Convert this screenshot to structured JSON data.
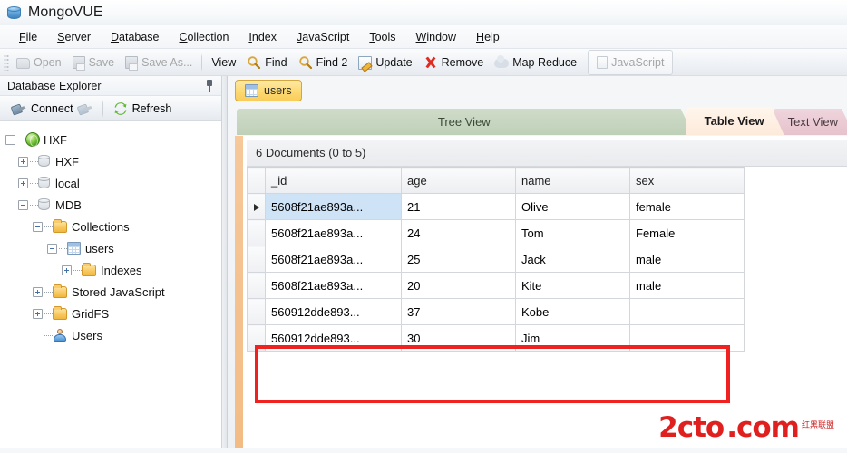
{
  "window": {
    "title": "MongoVUE",
    "icon": "database-icon"
  },
  "menu": {
    "items": [
      {
        "label": "File",
        "mnemonic": "F"
      },
      {
        "label": "Server",
        "mnemonic": "S"
      },
      {
        "label": "Database",
        "mnemonic": "D"
      },
      {
        "label": "Collection",
        "mnemonic": "C"
      },
      {
        "label": "Index",
        "mnemonic": "I"
      },
      {
        "label": "JavaScript",
        "mnemonic": "J"
      },
      {
        "label": "Tools",
        "mnemonic": "T"
      },
      {
        "label": "Window",
        "mnemonic": "W"
      },
      {
        "label": "Help",
        "mnemonic": "H"
      }
    ]
  },
  "toolbar": {
    "open_label": "Open",
    "save_label": "Save",
    "save_as_label": "Save As...",
    "view_label": "View",
    "find_label": "Find",
    "find2_label": "Find 2",
    "update_label": "Update",
    "remove_label": "Remove",
    "map_reduce_label": "Map Reduce",
    "javascript_label": "JavaScript"
  },
  "sidebar": {
    "caption": "Database Explorer",
    "connect_label": "Connect",
    "refresh_label": "Refresh",
    "tree": [
      {
        "label": "HXF",
        "icon": "globe-icon",
        "level": 0,
        "state": "expanded"
      },
      {
        "label": "HXF",
        "icon": "database-icon",
        "level": 1,
        "state": "collapsed"
      },
      {
        "label": "local",
        "icon": "database-icon",
        "level": 1,
        "state": "collapsed"
      },
      {
        "label": "MDB",
        "icon": "database-icon",
        "level": 1,
        "state": "expanded"
      },
      {
        "label": "Collections",
        "icon": "folder-icon",
        "level": 2,
        "state": "expanded"
      },
      {
        "label": "users",
        "icon": "collection-icon",
        "level": 3,
        "state": "expanded"
      },
      {
        "label": "Indexes",
        "icon": "folder-icon",
        "level": 4,
        "state": "collapsed"
      },
      {
        "label": "Stored JavaScript",
        "icon": "folder-icon",
        "level": 2,
        "state": "collapsed"
      },
      {
        "label": "GridFS",
        "icon": "folder-icon",
        "level": 2,
        "state": "collapsed"
      },
      {
        "label": "Users",
        "icon": "user-icon",
        "level": 2,
        "state": "leaf"
      }
    ]
  },
  "main": {
    "collection_tab": "users",
    "view_tabs": [
      {
        "label": "Tree View",
        "active": false
      },
      {
        "label": "Table View",
        "active": true
      },
      {
        "label": "Text View",
        "active": false
      }
    ],
    "document_count": "6 Documents (0 to 5)",
    "table": {
      "columns": [
        "_id",
        "age",
        "name",
        "sex"
      ],
      "rows": [
        {
          "_id": "5608f21ae893a...",
          "age": "21",
          "name": "Olive",
          "sex": "female",
          "selected": true,
          "highlighted": false
        },
        {
          "_id": "5608f21ae893a...",
          "age": "24",
          "name": "Tom",
          "sex": "Female",
          "selected": false,
          "highlighted": false
        },
        {
          "_id": "5608f21ae893a...",
          "age": "25",
          "name": "Jack",
          "sex": "male",
          "selected": false,
          "highlighted": false
        },
        {
          "_id": "5608f21ae893a...",
          "age": "20",
          "name": "Kite",
          "sex": "male",
          "selected": false,
          "highlighted": false
        },
        {
          "_id": "560912dde893...",
          "age": "37",
          "name": "Kobe",
          "sex": "",
          "selected": false,
          "highlighted": true
        },
        {
          "_id": "560912dde893...",
          "age": "30",
          "name": "Jim",
          "sex": "",
          "selected": false,
          "highlighted": true
        }
      ]
    }
  },
  "watermark": {
    "text": "2cto",
    "domain": ".com",
    "subtext": "红黑联盟"
  },
  "colors": {
    "accent_orange": "#f6c89a",
    "highlight_red": "#ef2121",
    "selection_blue": "#cfe3f7",
    "tab_active": "#fdeadb",
    "collection_tab": "#fcd971"
  }
}
